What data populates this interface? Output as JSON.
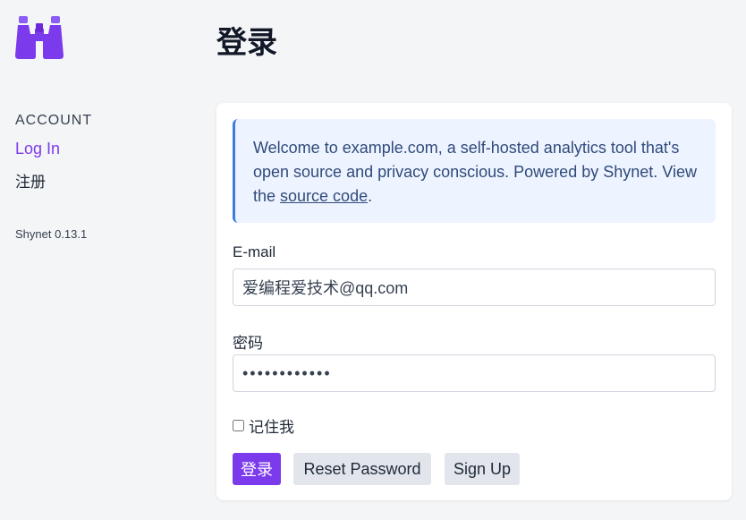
{
  "sidebar": {
    "logo_icon": "binoculars-icon",
    "heading": "ACCOUNT",
    "login_link": "Log In",
    "signup_link": "注册",
    "version": "Shynet 0.13.1"
  },
  "header": {
    "title": "登录"
  },
  "notice": {
    "text_before": "Welcome to example.com, a self-hosted analytics tool that's open source and privacy conscious. Powered by Shynet. View the ",
    "link_text": "source code",
    "text_after": "."
  },
  "form": {
    "email_label": "E-mail",
    "email_value": "爱编程爱技术@qq.com",
    "password_label": "密码",
    "password_value": "••••••••••••",
    "remember_label": "记住我",
    "remember_checked": false
  },
  "buttons": {
    "submit": "登录",
    "reset": "Reset Password",
    "signup": "Sign Up"
  },
  "colors": {
    "accent": "#7c3aed",
    "notice_bg": "#eef4ff",
    "notice_border": "#3b7ddd"
  }
}
